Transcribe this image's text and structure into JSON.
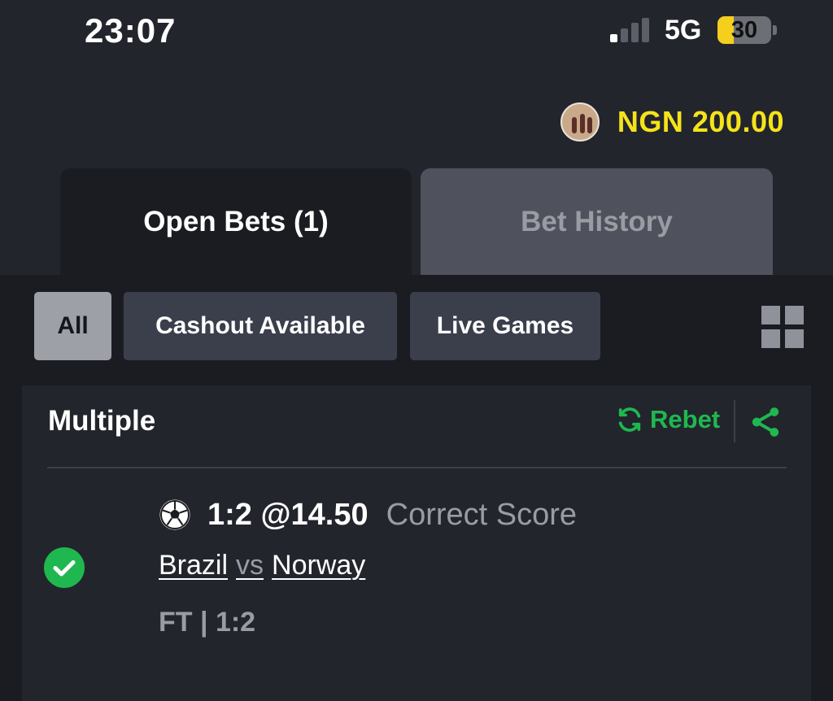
{
  "status_bar": {
    "time": "23:07",
    "network": "5G",
    "battery": "30",
    "battery_level_percent": 30,
    "icons": [
      "signal-bars-icon",
      "battery-icon"
    ]
  },
  "account": {
    "balance": "NGN 200.00",
    "avatar_icon": "avatar-photo"
  },
  "tabs": [
    {
      "label": "Open Bets (1)",
      "active": true
    },
    {
      "label": "Bet History",
      "active": false
    }
  ],
  "filters": [
    {
      "label": "All",
      "active": true
    },
    {
      "label": "Cashout Available",
      "active": false
    },
    {
      "label": "Live Games",
      "active": false
    }
  ],
  "view_toggle_icon": "grid-view-icon",
  "bet": {
    "title": "Multiple",
    "rebet_label": "Rebet",
    "icons": [
      "refresh-icon",
      "share-icon",
      "check-icon",
      "football-icon"
    ],
    "selection": {
      "pick": "1:2 @14.50",
      "market": "Correct Score",
      "home_team": "Brazil",
      "vs": "vs",
      "away_team": "Norway",
      "result": "FT | 1:2"
    }
  },
  "colors": {
    "background": "#23252d",
    "panel": "#1b1c22",
    "balance": "#f5e31a",
    "accent_green": "#1fb850",
    "muted_text": "#9a9ca4",
    "filter_button": "#3b3f4c"
  }
}
